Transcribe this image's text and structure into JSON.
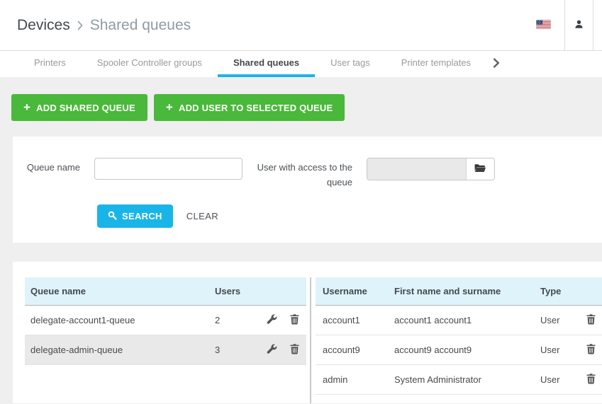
{
  "colors": {
    "accent_cyan": "#1ab5e8",
    "accent_green": "#4ab83a",
    "table_header_bg": "#dff3fb",
    "selected_row_bg": "#e9e9e9",
    "page_bg": "#efefef"
  },
  "icons": {
    "plus": "+"
  },
  "header": {
    "breadcrumb_root": "Devices",
    "breadcrumb_page": "Shared queues"
  },
  "tabs": {
    "items": [
      {
        "label": "Printers",
        "active": false
      },
      {
        "label": "Spooler Controller groups",
        "active": false
      },
      {
        "label": "Shared queues",
        "active": true
      },
      {
        "label": "User tags",
        "active": false
      },
      {
        "label": "Printer templates",
        "active": false
      }
    ]
  },
  "toolbar": {
    "add_shared_queue_label": "ADD SHARED QUEUE",
    "add_user_label": "ADD USER TO SELECTED QUEUE"
  },
  "search": {
    "queue_name_label": "Queue name",
    "queue_name_value": "",
    "user_access_label": "User with access to the queue",
    "user_access_value": "",
    "search_label": "SEARCH",
    "clear_label": "CLEAR"
  },
  "queues_table": {
    "headers": [
      "Queue name",
      "Users"
    ],
    "rows": [
      {
        "name": "delegate-account1-queue",
        "users": "2",
        "selected": false
      },
      {
        "name": "delegate-admin-queue",
        "users": "3",
        "selected": true
      }
    ]
  },
  "users_table": {
    "headers": [
      "Username",
      "First name and surname",
      "Type"
    ],
    "rows": [
      {
        "username": "account1",
        "full_name": "account1 account1",
        "type": "User"
      },
      {
        "username": "account9",
        "full_name": "account9 account9",
        "type": "User"
      },
      {
        "username": "admin",
        "full_name": "System Administrator",
        "type": "User"
      }
    ]
  }
}
